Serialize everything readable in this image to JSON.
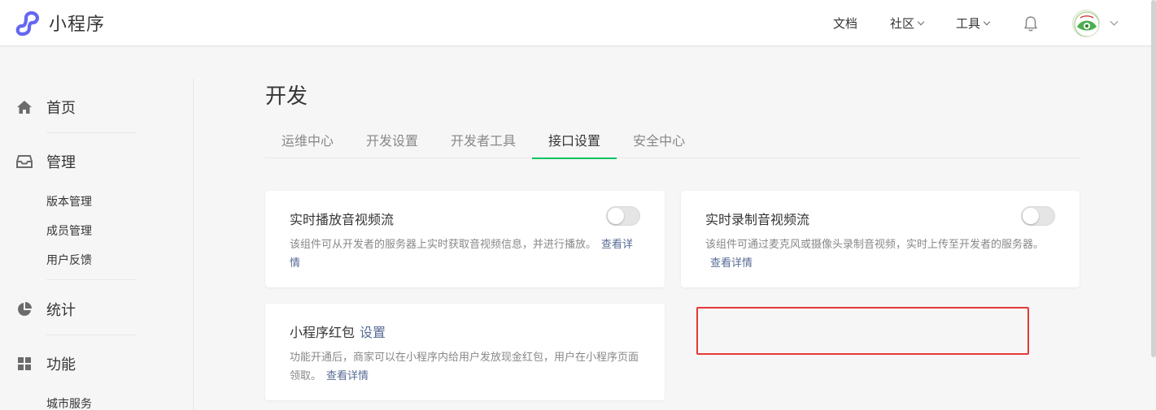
{
  "header": {
    "logo_text": "小程序",
    "nav": [
      {
        "label": "文档",
        "has_dropdown": false
      },
      {
        "label": "社区",
        "has_dropdown": true
      },
      {
        "label": "工具",
        "has_dropdown": true
      }
    ],
    "icons": [
      "bell-icon",
      "avatar",
      "chevron-down-icon"
    ]
  },
  "sidebar": {
    "sections": [
      {
        "label": "首页",
        "icon": "home-icon",
        "items": []
      },
      {
        "label": "管理",
        "icon": "inbox-icon",
        "items": [
          "版本管理",
          "成员管理",
          "用户反馈"
        ]
      },
      {
        "label": "统计",
        "icon": "pie-chart-icon",
        "items": []
      },
      {
        "label": "功能",
        "icon": "grid-icon",
        "items": [
          "城市服务"
        ]
      }
    ]
  },
  "main": {
    "title": "开发",
    "tabs": [
      {
        "label": "运维中心",
        "active": false
      },
      {
        "label": "开发设置",
        "active": false
      },
      {
        "label": "开发者工具",
        "active": false
      },
      {
        "label": "接口设置",
        "active": true
      },
      {
        "label": "安全中心",
        "active": false
      }
    ],
    "cards": [
      {
        "title": "实时播放音视频流",
        "description": "该组件可从开发者的服务器上实时获取音视频信息，并进行播放。",
        "link": "查看详情",
        "toggle_on": false
      },
      {
        "title": "实时录制音视频流",
        "description": "该组件可通过麦克风或摄像头录制音视频，实时上传至开发者的服务器。",
        "link": "查看详情",
        "toggle_on": false
      },
      {
        "title": "小程序红包",
        "title_link": "设置",
        "description": "功能开通后，商家可以在小程序内给用户发放现金红包，用户在小程序页面领取。",
        "link": "查看详情"
      }
    ]
  },
  "colors": {
    "accent_green": "#07c160",
    "link_blue": "#576b95",
    "logo_purple": "#6467f0",
    "highlight_red": "#e53935"
  }
}
